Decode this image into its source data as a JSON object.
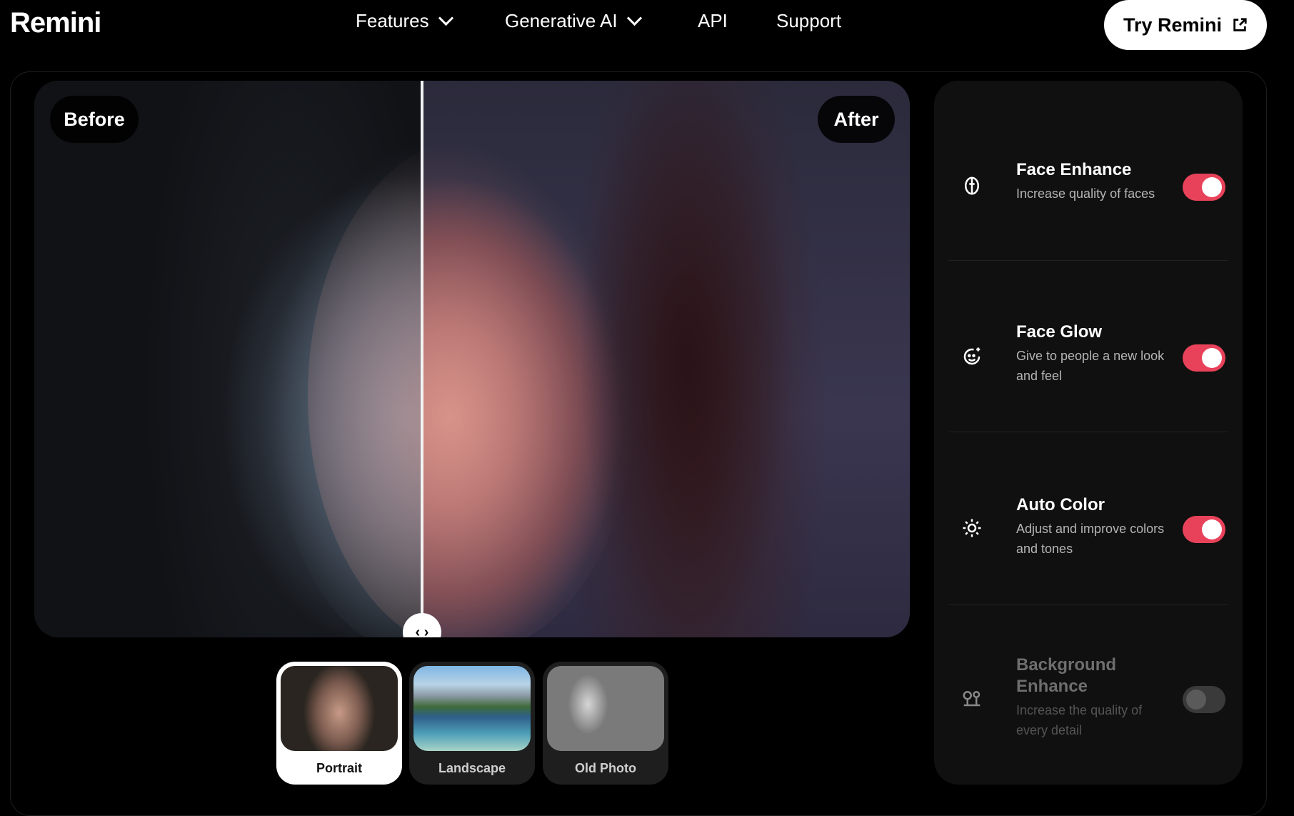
{
  "brand": {
    "logo": "Remini"
  },
  "nav": {
    "items": [
      {
        "label": "Features",
        "dropdown": true
      },
      {
        "label": "Generative AI",
        "dropdown": true
      },
      {
        "label": "API",
        "dropdown": false
      },
      {
        "label": "Support",
        "dropdown": false
      }
    ],
    "cta": {
      "label": "Try Remini",
      "icon": "external-link-icon"
    }
  },
  "compare": {
    "before_label": "Before",
    "after_label": "After",
    "handle_icon": "drag-horizontal-icon",
    "slider_position": 0.44
  },
  "thumbnails": [
    {
      "label": "Portrait",
      "active": true
    },
    {
      "label": "Landscape",
      "active": false
    },
    {
      "label": "Old Photo",
      "active": false
    }
  ],
  "features": [
    {
      "title": "Face Enhance",
      "description": "Increase quality of faces",
      "icon": "face-enhance-icon",
      "enabled": true,
      "available": true
    },
    {
      "title": "Face Glow",
      "description": "Give to people a new look and feel",
      "icon": "face-glow-icon",
      "enabled": true,
      "available": true
    },
    {
      "title": "Auto Color",
      "description": "Adjust and improve colors and tones",
      "icon": "sun-icon",
      "enabled": true,
      "available": true
    },
    {
      "title": "Background Enhance",
      "description": "Increase the quality of every detail",
      "icon": "background-trees-icon",
      "enabled": false,
      "available": false
    }
  ],
  "colors": {
    "accent": "#e8425a",
    "background": "#000000",
    "panel": "#101010",
    "toggle_off": "#3a3a3a"
  }
}
